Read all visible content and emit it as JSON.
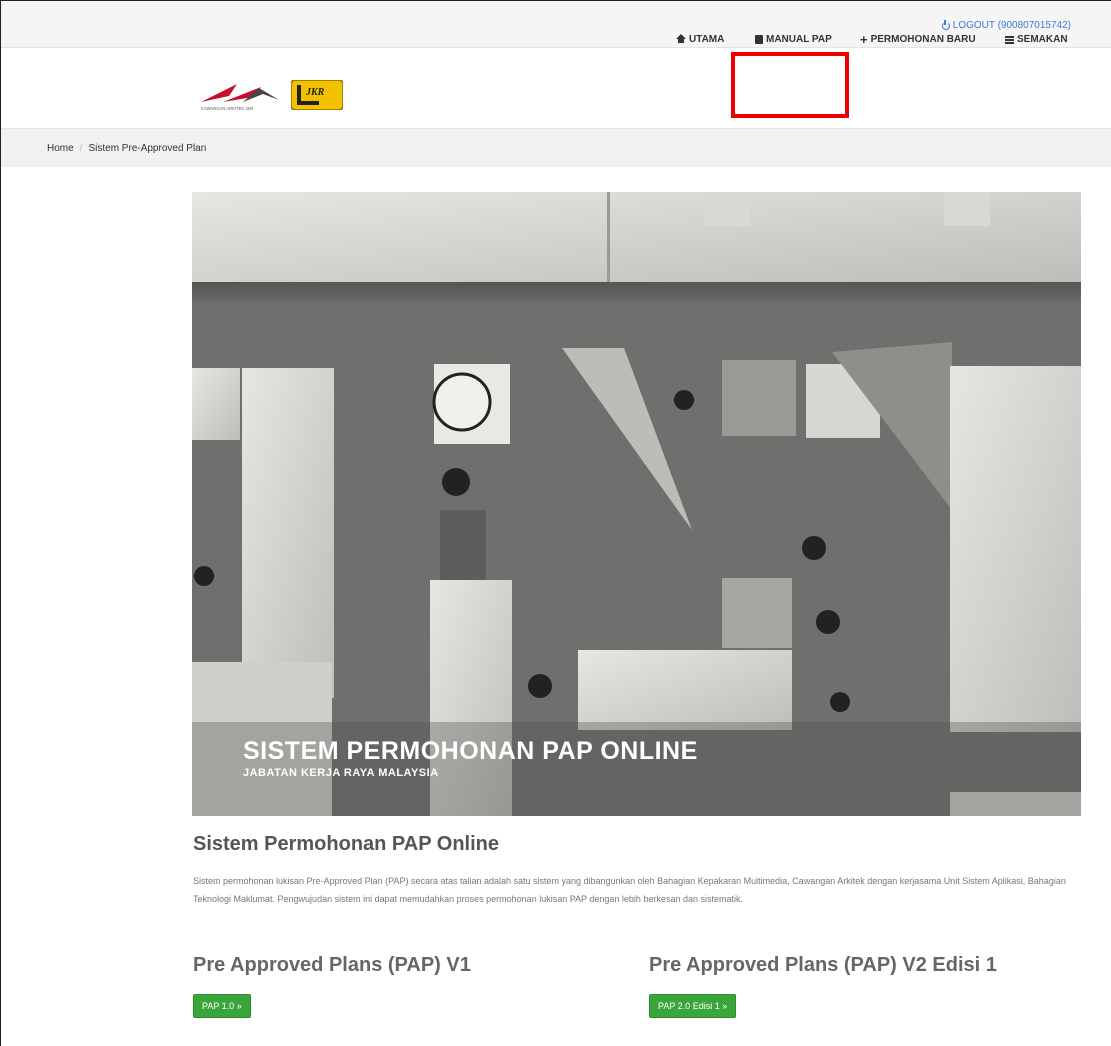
{
  "topbar": {
    "logout_label": "LOGOUT (900807015742)"
  },
  "header": {
    "logo_caption": "CAWANGAN ARKITEK JKR",
    "jkr_logo_text": "JKR",
    "nav": [
      {
        "label": "UTAMA",
        "icon": "home-icon"
      },
      {
        "label": "MANUAL PAP",
        "icon": "book-icon"
      },
      {
        "label": "PERMOHONAN BARU",
        "icon": "plus-icon"
      },
      {
        "label": "SEMAKAN",
        "icon": "list-icon"
      }
    ]
  },
  "breadcrumb": {
    "home": "Home",
    "current": "Sistem Pre-Approved Plan"
  },
  "hero": {
    "title": "SISTEM PERMOHONAN PAP ONLINE",
    "subtitle": "JABATAN KERJA RAYA MALAYSIA"
  },
  "main": {
    "title": "Sistem Permohonan PAP Online",
    "description": "Sistem permohonan lukisan Pre-Approved Plan (PAP) secara atas talian adalah satu sistem yang dibangunkan oleh Bahagian Kepakaran Multimedia, Cawangan Arkitek dengan kerjasama Unit Sistem Aplikasi, Bahagian Teknologi Maklumat. Pengwujudan sistem ini dapat memudahkan proses permohonan lukisan PAP dengan lebih berkesan dan sistematik.",
    "sections": [
      {
        "title": "Pre Approved Plans (PAP) V1",
        "button": "PAP 1.0 »"
      },
      {
        "title": "Pre Approved Plans (PAP) V2 Edisi 1",
        "button": "PAP 2.0 Edisi 1 »"
      }
    ]
  },
  "colors": {
    "accent_link": "#3a7bd5",
    "button_green": "#3aa53a",
    "highlight_red": "#ee0000"
  }
}
